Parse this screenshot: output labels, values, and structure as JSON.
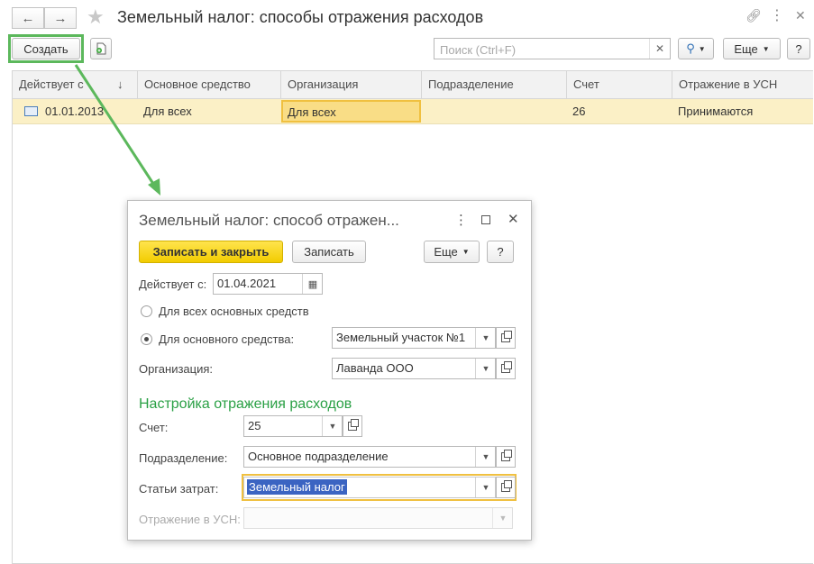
{
  "window": {
    "title": "Земельный налог: способы отражения расходов",
    "create_label": "Создать",
    "search_placeholder": "Поиск (Ctrl+F)",
    "more_label": "Еще",
    "help_label": "?"
  },
  "table": {
    "columns": [
      "Действует с",
      "Основное средство",
      "Организация",
      "Подразделение",
      "Счет",
      "Отражение в УСН"
    ],
    "sort_indicator": "↓",
    "rows": [
      {
        "date": "01.01.2013",
        "asset": "Для всех",
        "org": "Для всех",
        "division": "",
        "account": "26",
        "usn": "Принимаются"
      }
    ]
  },
  "dialog": {
    "title": "Земельный налог: способ отражен...",
    "save_close_label": "Записать и закрыть",
    "save_label": "Записать",
    "more_label": "Еще",
    "help_label": "?",
    "date_label": "Действует с:",
    "date_value": "01.04.2021",
    "radio_all_label": "Для всех основных средств",
    "radio_one_label": "Для основного средства:",
    "asset_value": "Земельный участок №1",
    "org_label": "Организация:",
    "org_value": "Лаванда ООО",
    "section_title": "Настройка отражения расходов",
    "account_label": "Счет:",
    "account_value": "25",
    "division_label": "Подразделение:",
    "division_value": "Основное подразделение",
    "cost_label": "Статьи затрат:",
    "cost_value": "Земельный налог",
    "usn_label": "Отражение в УСН:",
    "usn_value": ""
  },
  "colors": {
    "highlight_green": "#5cb85c",
    "row_selected": "#fbf0c6",
    "primary_button": "#f5d000",
    "section_green": "#2aa045"
  }
}
